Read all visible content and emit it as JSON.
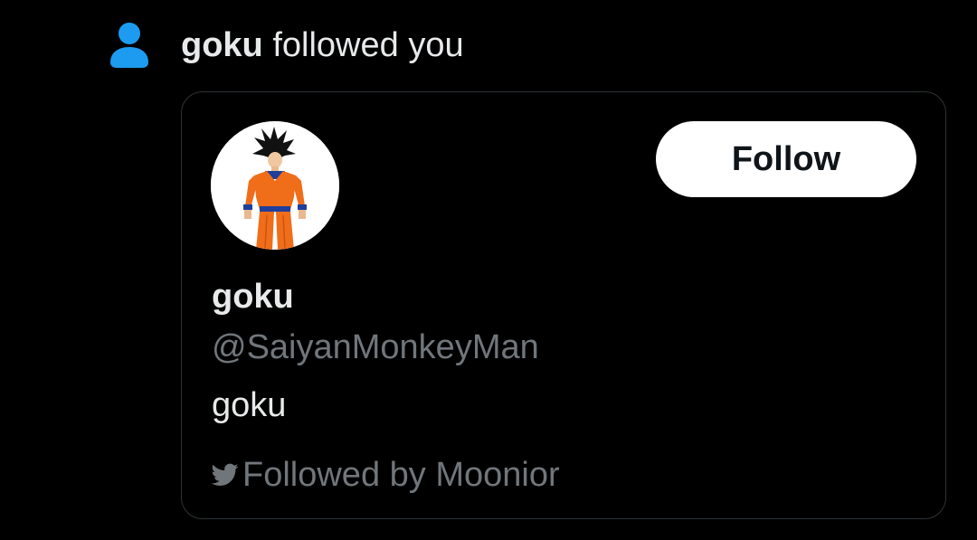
{
  "notification": {
    "icon": "person-icon",
    "icon_color": "#1d9bf0",
    "actor": "goku",
    "action": "followed you"
  },
  "user_card": {
    "avatar": "goku-avatar",
    "display_name": "goku",
    "handle": "@SaiyanMonkeyMan",
    "bio": "goku",
    "follow_label": "Follow",
    "followed_by_icon": "twitter-bird-icon",
    "followed_by": "Followed by Moonior"
  }
}
